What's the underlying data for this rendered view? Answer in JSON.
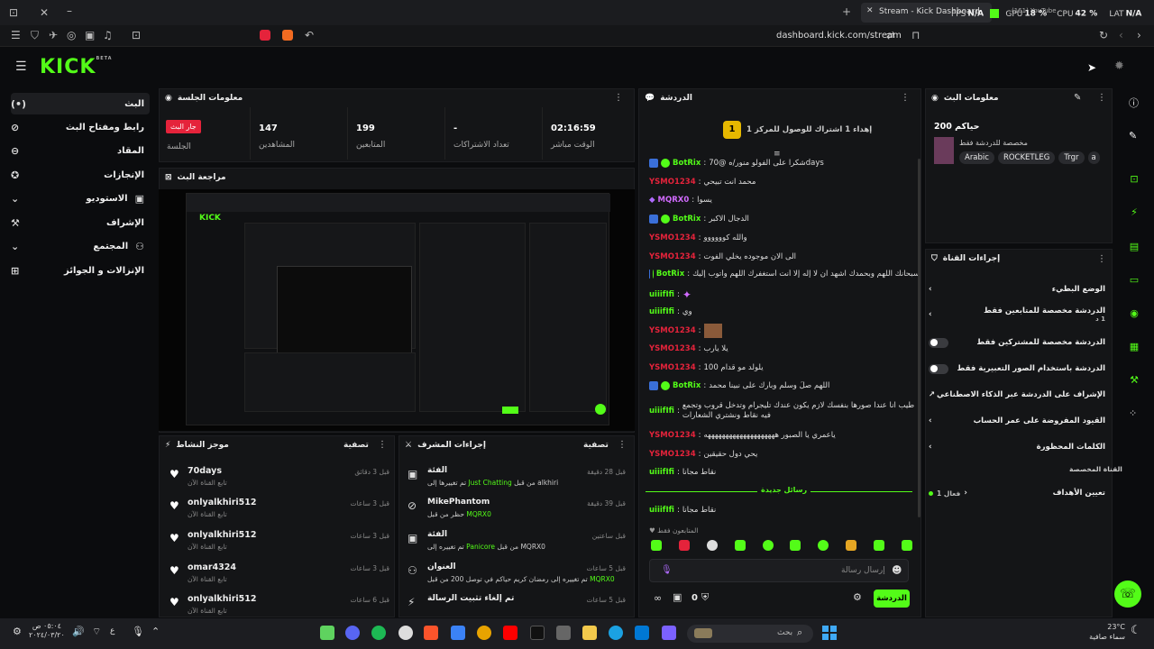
{
  "browser": {
    "tab_title": "Stream - Kick Dashboard",
    "other_tab": "(161) YouTube",
    "url": "dashboard.kick.com/stream",
    "stats": {
      "fps_label": "FPS",
      "fps": "N/A",
      "gpu_label": "GPU",
      "gpu": "18 %",
      "cpu_label": "CPU",
      "cpu": "42 %",
      "lat_label": "LAT",
      "lat": "N/A"
    }
  },
  "logo": {
    "text": "KICK",
    "sup": "BETA"
  },
  "sidebar": {
    "items": [
      {
        "label": "البث",
        "icon": "(•)"
      },
      {
        "label": "رابط ومفتاح البث",
        "icon": "⊘"
      },
      {
        "label": "المقاد",
        "icon": "⊘"
      },
      {
        "label": "الإنجازات",
        "icon": "✪"
      },
      {
        "label": "الاستوديو",
        "icon": "✍"
      },
      {
        "label": "الإشراف",
        "icon": "⚒"
      },
      {
        "label": "المجتمع",
        "icon": "✍"
      },
      {
        "label": "الإنزالات و الجوائز",
        "icon": "⊞"
      }
    ]
  },
  "session": {
    "title": "معلومات الجلسة",
    "badge": "جار البث",
    "badge_label": "الجلسة",
    "viewers": "147",
    "viewers_label": "المشاهدين",
    "followers": "199",
    "followers_label": "المتابعين",
    "subs": "-",
    "subs_label": "تعداد الاشتراكات",
    "time": "02:16:59",
    "time_label": "الوقت مباشر"
  },
  "preview": {
    "title": "مراجعة البث"
  },
  "activity": {
    "title": "موجز النشاط",
    "filter": "تصفية",
    "items": [
      {
        "name": "70days",
        "sub": "تابع القناة الآن",
        "time": "قبل 3 دقائق"
      },
      {
        "name": "onlyalkhiri512",
        "sub": "تابع القناة الآن",
        "time": "قبل 3 ساعات"
      },
      {
        "name": "onlyalkhiri512",
        "sub": "تابع القناة الآن",
        "time": "قبل 3 ساعات"
      },
      {
        "name": "omar4324",
        "sub": "تابع القناة الآن",
        "time": "قبل 3 ساعات"
      },
      {
        "name": "onlyalkhiri512",
        "sub": "تابع القناة الآن",
        "time": "قبل 6 ساعات"
      }
    ]
  },
  "modactions": {
    "title": "إجراءات المشرف",
    "filter": "تصفية",
    "items": [
      {
        "name": "الفئة",
        "sub_pre": "تم تغييرها إلى",
        "sub_em": "Just Chatting",
        "sub_post": "من قبل alkhiri",
        "time": "قبل 28 دقيقة"
      },
      {
        "name": "MikePhantom",
        "sub_pre": "حظر من قبل",
        "sub_em": "MQRX0",
        "sub_post": "",
        "time": "قبل 39 دقيقة"
      },
      {
        "name": "الفئة",
        "sub_pre": "تم تغييره إلى",
        "sub_em": "Panicore",
        "sub_post": "من قبل MQRX0",
        "time": "قبل ساعتين"
      },
      {
        "name": "العنوان",
        "sub_pre": "تم تغييره إلى رمضان كريم حياكم في توصل 200 من قبل",
        "sub_em": "MQRX0",
        "sub_post": "",
        "time": "قبل 5 ساعات"
      },
      {
        "name": "تم إلغاء تثبيت الرسالة",
        "sub_pre": "",
        "sub_em": "",
        "sub_post": "",
        "time": "قبل 5 ساعات"
      }
    ]
  },
  "chat": {
    "title": "الدردشة",
    "goal": "إهداء 1 اشتراك للوصول للمركز 1",
    "goal_rank": "1",
    "messages": [
      {
        "user": "BotRix",
        "cls": "bot",
        "text": "شكرا على الفولو منور/ه @70days",
        "bot": true
      },
      {
        "user": "YSMO1234",
        "cls": "mod",
        "text": "محمد انت تبيحي",
        "bot": false
      },
      {
        "user": "MQRX0",
        "cls": "purple",
        "text": "يسوا",
        "bot": false
      },
      {
        "user": "BotRix",
        "cls": "bot",
        "text": "الدجال الاكبر",
        "bot": true
      },
      {
        "user": "YSMO1234",
        "cls": "mod",
        "text": "والله كوووووو",
        "bot": false
      },
      {
        "user": "YSMO1234",
        "cls": "mod",
        "text": "الى الان موجوده يخلي الفوت",
        "bot": false
      },
      {
        "user": "BotRix",
        "cls": "bot",
        "text": "سبحانك اللهم وبحمدك اشهد ان لا إله إلا أنت أستغفرك اللهم وأتوب إليك",
        "bot": true
      },
      {
        "user": "uiiifIfi",
        "cls": "green2",
        "text": "",
        "bot": false
      },
      {
        "user": "uiiifIfi",
        "cls": "green2",
        "text": "وي",
        "bot": false
      },
      {
        "user": "YSMO1234",
        "cls": "mod",
        "text": "",
        "bot": false
      },
      {
        "user": "YSMO1234",
        "cls": "mod",
        "text": "يلا يارب",
        "bot": false
      },
      {
        "user": "YSMO1234",
        "cls": "mod",
        "text": "يلولد مو قدام 100",
        "bot": false
      },
      {
        "user": "BotRix",
        "cls": "bot",
        "text": "اللهم صلِّ وسلم وبارك على نبينا محمد",
        "bot": true
      },
      {
        "user": "uiiifIfi",
        "cls": "green2",
        "text": "طيب انا عندا صورها بنفسك لازم يكون عندك تليجرام وتدخل قروب وتجمع فيه نقاط ونشتري الشعارات",
        "bot": false
      },
      {
        "user": "YSMO1234",
        "cls": "mod",
        "text": "ياعمري يا الصبور ههههههههههههههههههههه",
        "bot": false
      },
      {
        "user": "YSMO1234",
        "cls": "mod",
        "text": "يحي دول حقيقين",
        "bot": false
      },
      {
        "user": "uiiifIfi",
        "cls": "green2",
        "text": "نقاط مجانا",
        "bot": false
      }
    ],
    "new_messages": "رسائل جديدة",
    "after_new": {
      "user": "uiiifIfi",
      "text": "نقاط مجاناً"
    },
    "followers_only": "المتابعون فقط",
    "input_placeholder": "إرسال رسالة",
    "count": "0",
    "send": "الدردشة"
  },
  "streaminfo": {
    "title": "معلومات البث",
    "stream_title": "حياكم 200",
    "category": "مخصصة للدردشة فقط",
    "tags": [
      "Arabic",
      "ROCKETLEG",
      "Trgr",
      "a"
    ]
  },
  "channel_actions": {
    "title": "إجراءات القناة",
    "items": [
      {
        "label": "الوضع البطيء",
        "kind": "arrow"
      },
      {
        "label": "الدردشة مخصصة للمتابعين فقط",
        "sub": "1 د",
        "kind": "arrow"
      },
      {
        "label": "الدردشة مخصصة للمشتركين فقط",
        "kind": "toggle"
      },
      {
        "label": "الدردشة باستخدام الصور التعبيرية فقط",
        "kind": "toggle"
      },
      {
        "label": "الإشراف على الدردشة عبر الذكاء الاصطناعي",
        "kind": "ext"
      },
      {
        "label": "القيود المفروضة على عمر الحساب",
        "kind": "arrow"
      },
      {
        "label": "الكلمات المحظورة",
        "kind": "arrow"
      }
    ],
    "section": "القناة المخصصة",
    "goals_label": "تعيين الأهداف",
    "goals_value": "فعال 1"
  },
  "taskbar": {
    "weather_temp": "23°C",
    "weather_desc": "سماء صافية",
    "search": "بحث",
    "time": "٠٥:٠٤ ص",
    "date": "٢٠٢٤/٠٣/٢٠"
  },
  "colors": {
    "accent": "#53fc18",
    "live": "#e5233b",
    "bg": "#0b0c0e",
    "panel": "#141517"
  }
}
